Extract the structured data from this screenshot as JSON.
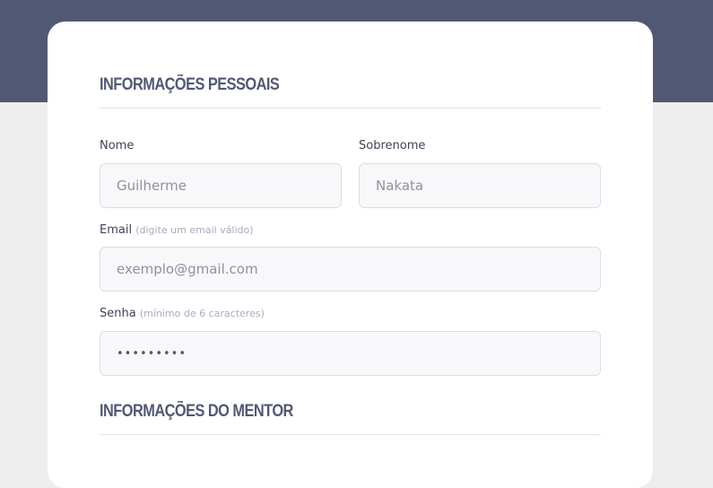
{
  "sections": {
    "personal_title": "Informações Pessoais",
    "mentor_title": "Informações do Mentor"
  },
  "fields": {
    "first_name": {
      "label": "Nome",
      "placeholder": "Guilherme"
    },
    "last_name": {
      "label": "Sobrenome",
      "placeholder": "Nakata"
    },
    "email": {
      "label": "Email",
      "hint": "(digite um email válido)",
      "placeholder": "exemplo@gmail.com"
    },
    "password": {
      "label": "Senha",
      "hint": "(mínimo de 6 caracteres)",
      "value": "•••••••••"
    }
  },
  "colors": {
    "header_band": "#525873",
    "page_background": "#eeeeee",
    "card": "#ffffff",
    "title_text": "#525873",
    "input_background": "#f8f8fa",
    "input_border": "#dcdee6"
  }
}
